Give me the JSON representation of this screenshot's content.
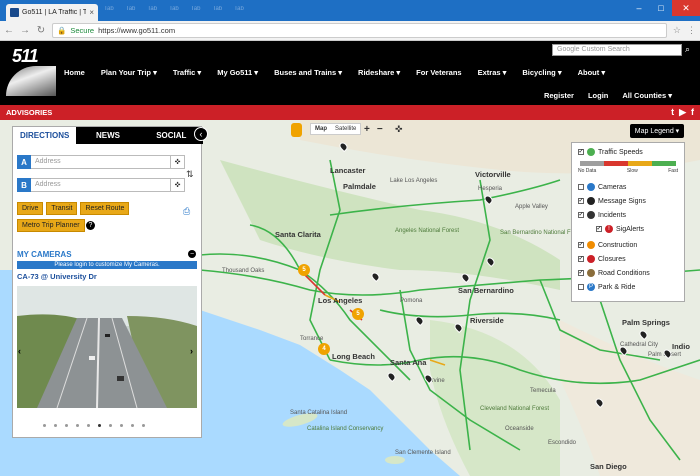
{
  "browser": {
    "tab_title": "Go511 | LA Traffic | Trip...",
    "background_tabs": [
      "Tab",
      "Tab",
      "Tab",
      "Tab",
      "Tab",
      "Tab",
      "Tab"
    ],
    "secure_label": "Secure",
    "url": "https://www.go511.com"
  },
  "header": {
    "logo_text": "511",
    "search_placeholder": "Google Custom Search",
    "nav": [
      "Home",
      "Plan Your Trip ▾",
      "Traffic ▾",
      "My Go511 ▾",
      "Buses and Trains ▾",
      "Rideshare ▾",
      "For Veterans",
      "Extras ▾",
      "Bicycling ▾",
      "About ▾"
    ],
    "subnav": [
      "Register",
      "Login",
      "All Counties ▾"
    ]
  },
  "advisories": {
    "label": "ADVISORIES",
    "social": [
      "t",
      "▶",
      "f"
    ]
  },
  "panel": {
    "tabs": [
      "DIRECTIONS",
      "NEWS",
      "SOCIAL"
    ],
    "address_a_letter": "A",
    "address_b_letter": "B",
    "address_placeholder": "Address",
    "buttons": [
      "Drive",
      "Transit",
      "Reset Route"
    ],
    "metro_button": "Metro Trip Planner",
    "my_cameras": "MY CAMERAS",
    "login_note": "Please login to customize My Cameras.",
    "camera_title": "CA-73 @ University Dr"
  },
  "map_controls": {
    "map_label": "Map",
    "satellite_label": "Satellite",
    "zoom_in": "+",
    "zoom_out": "−",
    "legend_button": "Map Legend ▾"
  },
  "legend": {
    "traffic_speeds": "Traffic Speeds",
    "speed_labels": [
      "No Data",
      "Slow",
      "Fast"
    ],
    "speed_colors": [
      "#9e9e9e",
      "#d9372e",
      "#e8a818",
      "#4caf50"
    ],
    "items": [
      "Cameras",
      "Message Signs",
      "Incidents",
      "SigAlerts",
      "Construction",
      "Closures",
      "Road Conditions",
      "Park & Ride"
    ]
  },
  "map_labels": {
    "cities": [
      "Lancaster",
      "Palmdale",
      "Lake Los Angeles",
      "Victorville",
      "Hesperia",
      "Apple Valley",
      "Santa Clarita",
      "Thousand Oaks",
      "Los Angeles",
      "San Bernardino",
      "Riverside",
      "Pomona",
      "Santa Ana",
      "Long Beach",
      "Torrance",
      "Irvine",
      "Temecula",
      "Palm Springs",
      "Cathedral City",
      "Palm Desert",
      "Indio",
      "Oceanside",
      "Escondido",
      "San Diego"
    ],
    "parks": [
      "Angeles National Forest",
      "San Bernardino National Forest",
      "Cleveland National Forest",
      "Catalina Island Conservancy",
      "Santa Catalina Island",
      "San Clemente Island"
    ]
  }
}
